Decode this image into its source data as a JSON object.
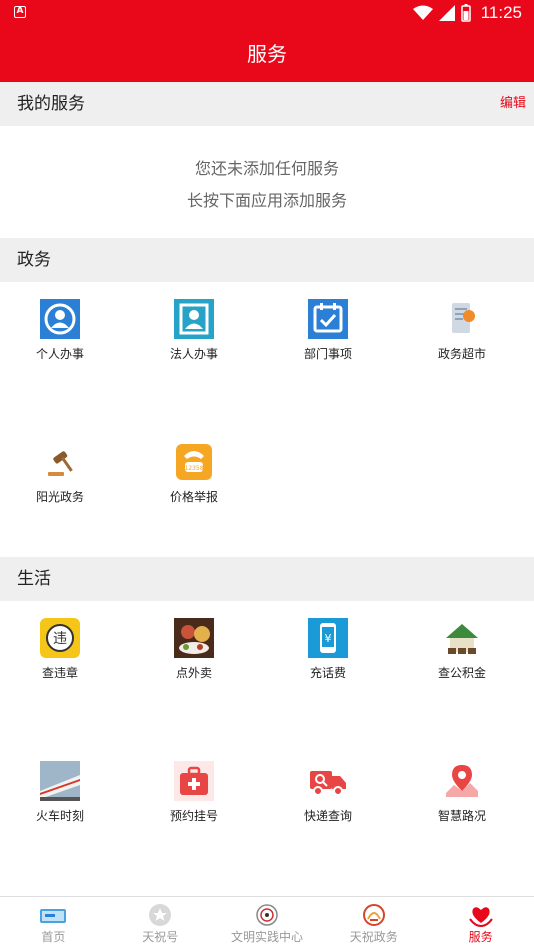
{
  "status_bar": {
    "time": "11:25"
  },
  "header": {
    "title": "服务"
  },
  "my_services": {
    "title": "我的服务",
    "edit_label": "编辑",
    "empty_line1": "您还未添加任何服务",
    "empty_line2": "长按下面应用添加服务"
  },
  "gov": {
    "title": "政务",
    "items": [
      {
        "label": "个人办事",
        "icon": "personal-affairs-icon"
      },
      {
        "label": "法人办事",
        "icon": "legal-person-icon"
      },
      {
        "label": "部门事项",
        "icon": "department-calendar-icon"
      },
      {
        "label": "政务超市",
        "icon": "gov-market-icon"
      },
      {
        "label": "阳光政务",
        "icon": "gavel-icon"
      },
      {
        "label": "价格举报",
        "icon": "price-hotline-icon"
      }
    ]
  },
  "life": {
    "title": "生活",
    "items": [
      {
        "label": "查违章",
        "icon": "traffic-violation-icon"
      },
      {
        "label": "点外卖",
        "icon": "food-delivery-icon"
      },
      {
        "label": "充话费",
        "icon": "phone-recharge-icon"
      },
      {
        "label": "查公积金",
        "icon": "housing-fund-icon"
      },
      {
        "label": "火车时刻",
        "icon": "train-icon"
      },
      {
        "label": "预约挂号",
        "icon": "medical-kit-icon"
      },
      {
        "label": "快递查询",
        "icon": "delivery-truck-icon"
      },
      {
        "label": "智慧路况",
        "icon": "map-pin-icon"
      }
    ]
  },
  "tabs": [
    {
      "label": "首页",
      "icon": "home-icon",
      "active": false
    },
    {
      "label": "天祝号",
      "icon": "star-badge-icon",
      "active": false
    },
    {
      "label": "文明实践中心",
      "icon": "emblem-icon",
      "active": false
    },
    {
      "label": "天祝政务",
      "icon": "gov-logo-icon",
      "active": false
    },
    {
      "label": "服务",
      "icon": "heart-hands-icon",
      "active": true
    }
  ],
  "colors": {
    "brand_red": "#e8081a",
    "section_bg": "#efefef"
  }
}
